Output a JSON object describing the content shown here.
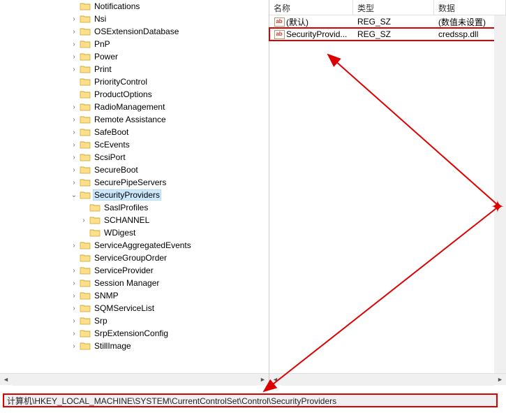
{
  "tree": {
    "items": [
      {
        "indent": 7,
        "expand": "",
        "label": "Notifications"
      },
      {
        "indent": 7,
        "expand": ">",
        "label": "Nsi"
      },
      {
        "indent": 7,
        "expand": ">",
        "label": "OSExtensionDatabase"
      },
      {
        "indent": 7,
        "expand": ">",
        "label": "PnP"
      },
      {
        "indent": 7,
        "expand": ">",
        "label": "Power"
      },
      {
        "indent": 7,
        "expand": ">",
        "label": "Print"
      },
      {
        "indent": 7,
        "expand": "",
        "label": "PriorityControl"
      },
      {
        "indent": 7,
        "expand": "",
        "label": "ProductOptions"
      },
      {
        "indent": 7,
        "expand": ">",
        "label": "RadioManagement"
      },
      {
        "indent": 7,
        "expand": ">",
        "label": "Remote Assistance"
      },
      {
        "indent": 7,
        "expand": ">",
        "label": "SafeBoot"
      },
      {
        "indent": 7,
        "expand": ">",
        "label": "ScEvents"
      },
      {
        "indent": 7,
        "expand": ">",
        "label": "ScsiPort"
      },
      {
        "indent": 7,
        "expand": ">",
        "label": "SecureBoot"
      },
      {
        "indent": 7,
        "expand": ">",
        "label": "SecurePipeServers"
      },
      {
        "indent": 7,
        "expand": "v",
        "label": "SecurityProviders",
        "selected": true
      },
      {
        "indent": 8,
        "expand": "",
        "label": "SaslProfiles"
      },
      {
        "indent": 8,
        "expand": ">",
        "label": "SCHANNEL"
      },
      {
        "indent": 8,
        "expand": "",
        "label": "WDigest"
      },
      {
        "indent": 7,
        "expand": ">",
        "label": "ServiceAggregatedEvents"
      },
      {
        "indent": 7,
        "expand": "",
        "label": "ServiceGroupOrder"
      },
      {
        "indent": 7,
        "expand": ">",
        "label": "ServiceProvider"
      },
      {
        "indent": 7,
        "expand": ">",
        "label": "Session Manager"
      },
      {
        "indent": 7,
        "expand": ">",
        "label": "SNMP"
      },
      {
        "indent": 7,
        "expand": ">",
        "label": "SQMServiceList"
      },
      {
        "indent": 7,
        "expand": ">",
        "label": "Srp"
      },
      {
        "indent": 7,
        "expand": ">",
        "label": "SrpExtensionConfig"
      },
      {
        "indent": 7,
        "expand": ">",
        "label": "StillImage"
      }
    ]
  },
  "columns": {
    "name": "名称",
    "type": "类型",
    "data": "数据"
  },
  "values": [
    {
      "name": "(默认)",
      "type": "REG_SZ",
      "data": "(数值未设置)",
      "highlighted": false
    },
    {
      "name": "SecurityProvid...",
      "type": "REG_SZ",
      "data": "credssp.dll",
      "highlighted": true
    }
  ],
  "status": "计算机\\HKEY_LOCAL_MACHINE\\SYSTEM\\CurrentControlSet\\Control\\SecurityProviders"
}
